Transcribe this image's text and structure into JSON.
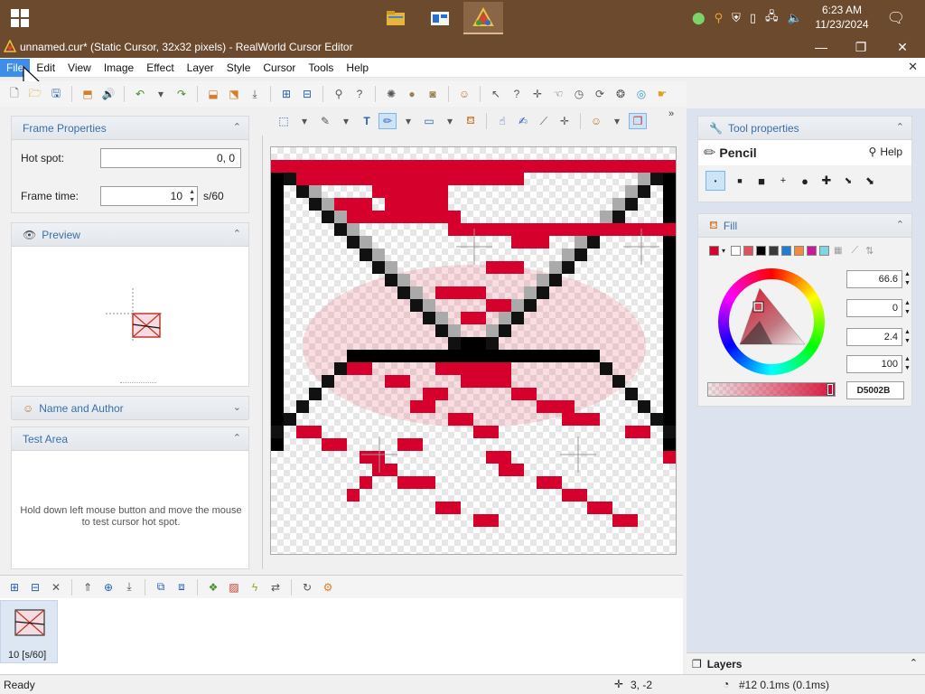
{
  "taskbar": {
    "clock_time": "6:23 AM",
    "clock_date": "11/23/2024"
  },
  "window": {
    "title": "unnamed.cur* (Static Cursor, 32x32 pixels) - RealWorld Cursor Editor",
    "minimize": "—",
    "maximize": "❐",
    "close": "✕"
  },
  "menu": {
    "items": [
      "File",
      "Edit",
      "View",
      "Image",
      "Effect",
      "Layer",
      "Style",
      "Cursor",
      "Tools",
      "Help"
    ],
    "close": "✕"
  },
  "frame_properties": {
    "title": "Frame Properties",
    "hotspot_label": "Hot spot:",
    "hotspot_value": "0, 0",
    "frametime_label": "Frame time:",
    "frametime_value": "10",
    "frametime_unit": "s/60"
  },
  "preview": {
    "title": "Preview"
  },
  "name_author": {
    "title": "Name and Author"
  },
  "test_area": {
    "title": "Test Area",
    "hint": "Hold down left mouse button and move the mouse to test cursor hot spot."
  },
  "frames": {
    "frame_label": "10 [s/60]"
  },
  "tool_properties": {
    "title": "Tool properties",
    "tool_name": "Pencil",
    "help_label": "Help"
  },
  "fill": {
    "title": "Fill",
    "values": [
      "66.6",
      "0",
      "2.4",
      "100"
    ],
    "hex": "D5002B",
    "color": "#D5002B",
    "palette": [
      "#d5002b",
      "#ffffff",
      "#e05060",
      "#000000",
      "#3a3a3a",
      "#1e7fd0",
      "#f08c3c",
      "#c61a9a",
      "#7fd6e0"
    ]
  },
  "layers": {
    "title": "Layers"
  },
  "status": {
    "ready": "Ready",
    "coords": "3, -2",
    "frame_info": "#12 0.1ms (0.1ms)"
  }
}
